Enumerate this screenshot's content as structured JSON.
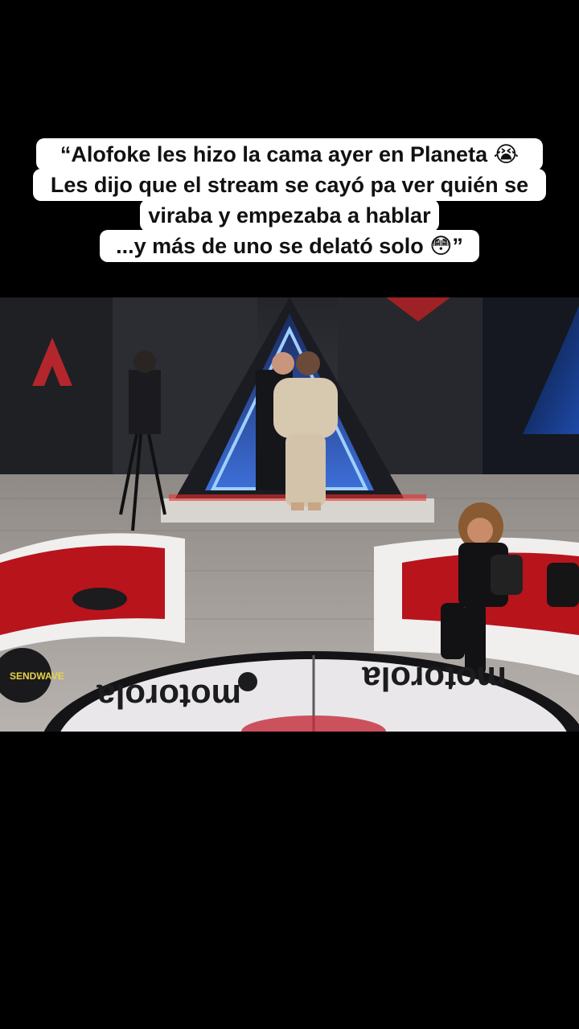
{
  "caption": {
    "lines": [
      "“Alofoke les hizo la cama ayer en Planeta 😭",
      "Les dijo que el stream se cayó pa ver quién se",
      "viraba y empezaba a hablar",
      "...y más de uno se delató solo 😳”"
    ]
  },
  "video": {
    "floor_logo_text": "motorola",
    "cushion_brand": "SENDWAVE"
  }
}
